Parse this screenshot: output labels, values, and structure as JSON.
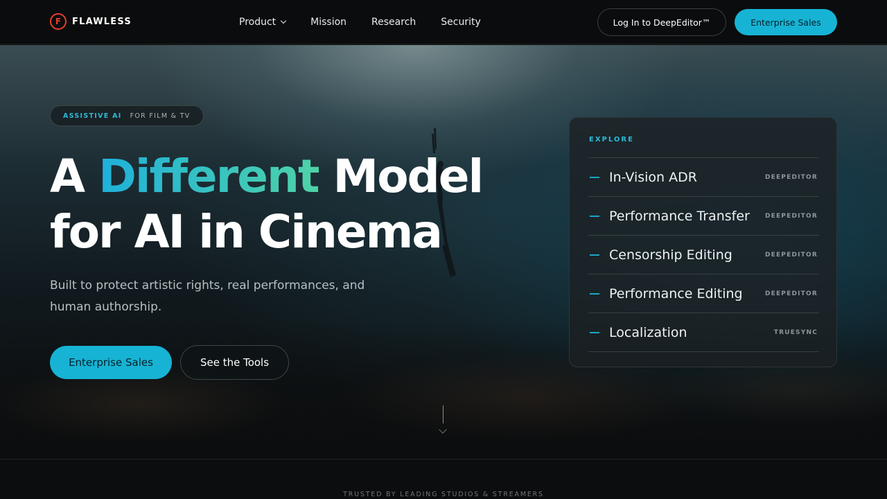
{
  "brand": {
    "name": "FLAWLESS",
    "logo_letter": "F",
    "color": "#e8402d"
  },
  "nav": {
    "items": [
      {
        "label": "Product",
        "dropdown": true
      },
      {
        "label": "Mission"
      },
      {
        "label": "Research"
      },
      {
        "label": "Security"
      }
    ],
    "login_label": "Log In to DeepEditor™",
    "sales_label": "Enterprise Sales"
  },
  "hero": {
    "badge_primary": "ASSISTIVE AI",
    "badge_secondary": "FOR FILM & TV",
    "headline_pre": "A",
    "headline_accent": "Different",
    "headline_post": "Model",
    "headline_line2": "for AI in Cinema",
    "subtext": "Built to protect artistic rights, real performances, and human authorship.",
    "primary_button": "Enterprise Sales",
    "secondary_button": "See the Tools"
  },
  "explore": {
    "title": "EXPLORE",
    "items": [
      {
        "label": "In-Vision ADR",
        "tag": "DEEPEDITOR"
      },
      {
        "label": "Performance Transfer",
        "tag": "DEEPEDITOR"
      },
      {
        "label": "Censorship Editing",
        "tag": "DEEPEDITOR"
      },
      {
        "label": "Performance Editing",
        "tag": "DEEPEDITOR"
      },
      {
        "label": "Localization",
        "tag": "TRUESYNC"
      }
    ]
  },
  "trusted_text": "TRUSTED BY LEADING STUDIOS & STREAMERS",
  "colors": {
    "accent": "#17b3d4",
    "gradient_start": "#1fb0da",
    "gradient_end": "#4fd3a8"
  }
}
